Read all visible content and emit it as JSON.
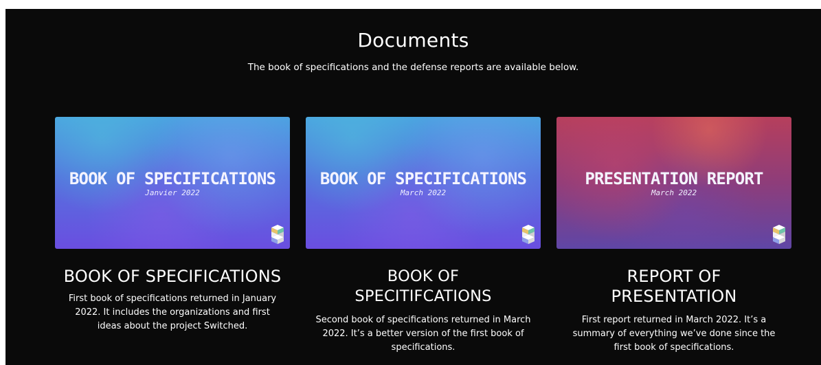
{
  "section": {
    "title": "Documents",
    "subtitle": "The book of specifications and the defense reports are available below."
  },
  "cards": [
    {
      "thumb_title": "BOOK OF SPECIFICATIONS",
      "thumb_date": "Janvier 2022",
      "heading": "BOOK OF SPECIFICATIONS",
      "description": "First book of specifications returned in January 2022. It includes the organizations and first ideas about the project Switched.",
      "logo_icon": "switched-logo-icon"
    },
    {
      "thumb_title": "BOOK OF SPECIFICATIONS",
      "thumb_date": "March 2022",
      "heading": "BOOK OF SPECITIFCATIONS",
      "description": "Second book of specifications returned in March 2022. It’s a better version of the first book of specifications.",
      "logo_icon": "switched-logo-icon"
    },
    {
      "thumb_title": "PRESENTATION REPORT",
      "thumb_date": "March 2022",
      "heading": "REPORT OF PRESENTATION",
      "description": "First report returned in March 2022. It’s a summary of everything we’ve done since the first book of specifications.",
      "logo_icon": "switched-logo-icon"
    }
  ],
  "colors": {
    "background": "#0a0a0a",
    "text": "#ffffff",
    "thumb_blue": "#5572de",
    "thumb_red": "#b63f5c"
  }
}
